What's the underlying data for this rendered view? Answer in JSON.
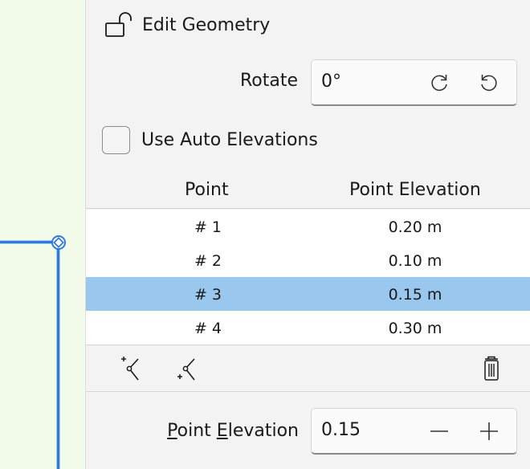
{
  "header": {
    "title": "Edit Geometry",
    "icon": "unlocked-padlock-icon"
  },
  "rotate": {
    "label": "Rotate",
    "value": "0°"
  },
  "auto_elevations": {
    "label": "Use Auto Elevations",
    "checked": false
  },
  "table": {
    "columns": [
      "Point",
      "Point Elevation"
    ],
    "rows": [
      {
        "point": "# 1",
        "elevation": "0.20 m"
      },
      {
        "point": "# 2",
        "elevation": "0.10 m"
      },
      {
        "point": "# 3",
        "elevation": "0.15 m"
      },
      {
        "point": "# 4",
        "elevation": "0.30 m"
      }
    ],
    "selected_index": 2
  },
  "point_elevation": {
    "label_part1": "P",
    "label_part2": "oint ",
    "label_part3": "E",
    "label_part4": "levation",
    "value": "0.15"
  },
  "colors": {
    "selection": "#99c7ee",
    "geometry": "#2f7bd8",
    "canvas": "#f3fbea"
  }
}
